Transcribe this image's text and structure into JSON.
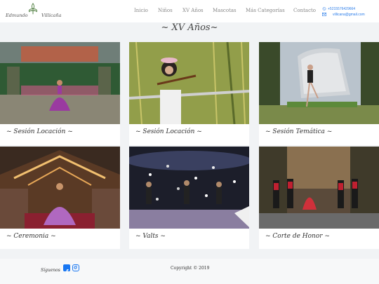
{
  "brand": {
    "name_left": "Edmundo",
    "name_right": "Villicaña"
  },
  "nav": {
    "items": [
      {
        "label": "Inicio"
      },
      {
        "label": "Niños"
      },
      {
        "label": "XV Años"
      },
      {
        "label": "Mascotas"
      },
      {
        "label": "Más Categorías"
      },
      {
        "label": "Contacto"
      }
    ]
  },
  "contact": {
    "phone": "+5215576429664",
    "email": "villicana@gmail.com"
  },
  "page": {
    "title": "~ XV Años~"
  },
  "cards": [
    {
      "label": "~ Sesión Locación ~"
    },
    {
      "label": "~ Sesión Locación ~"
    },
    {
      "label": "~ Sesión Temática ~"
    },
    {
      "label": "~ Ceremonia ~"
    },
    {
      "label": "~ Valts ~"
    },
    {
      "label": "~ Corte de Honor ~"
    }
  ],
  "footer": {
    "follow_label": "Síguenos",
    "copyright": "Copyright © 2019"
  },
  "colors": {
    "accent": "#2b7de9",
    "facebook": "#1877f2",
    "background": "#f1f3f5"
  }
}
